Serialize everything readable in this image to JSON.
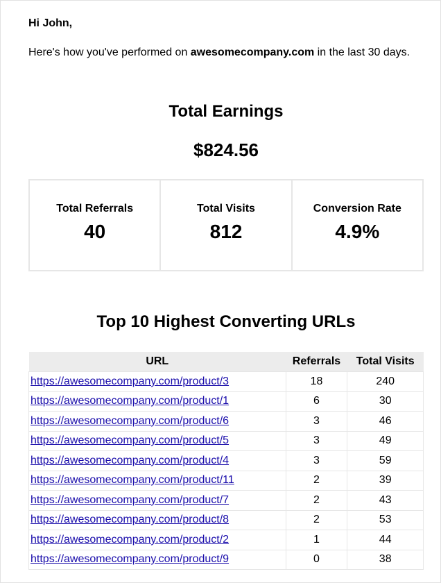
{
  "greeting": "Hi John,",
  "intro": {
    "prefix": "Here's how you've performed on ",
    "domain": "awesomecompany.com",
    "suffix": " in the last 30 days."
  },
  "earnings": {
    "title": "Total Earnings",
    "value": "$824.56"
  },
  "stats": [
    {
      "label": "Total Referrals",
      "value": "40"
    },
    {
      "label": "Total Visits",
      "value": "812"
    },
    {
      "label": "Conversion Rate",
      "value": "4.9%"
    }
  ],
  "top_urls": {
    "title": "Top 10 Highest Converting URLs",
    "headers": [
      "URL",
      "Referrals",
      "Total Visits"
    ],
    "rows": [
      {
        "url": "https://awesomecompany.com/product/3",
        "referrals": "18",
        "visits": "240"
      },
      {
        "url": "https://awesomecompany.com/product/1",
        "referrals": "6",
        "visits": "30"
      },
      {
        "url": "https://awesomecompany.com/product/6",
        "referrals": "3",
        "visits": "46"
      },
      {
        "url": "https://awesomecompany.com/product/5",
        "referrals": "3",
        "visits": "49"
      },
      {
        "url": "https://awesomecompany.com/product/4",
        "referrals": "3",
        "visits": "59"
      },
      {
        "url": "https://awesomecompany.com/product/11",
        "referrals": "2",
        "visits": "39"
      },
      {
        "url": "https://awesomecompany.com/product/7",
        "referrals": "2",
        "visits": "43"
      },
      {
        "url": "https://awesomecompany.com/product/8",
        "referrals": "2",
        "visits": "53"
      },
      {
        "url": "https://awesomecompany.com/product/2",
        "referrals": "1",
        "visits": "44"
      },
      {
        "url": "https://awesomecompany.com/product/9",
        "referrals": "0",
        "visits": "38"
      }
    ]
  },
  "colors": {
    "link": "#1a0dab",
    "header_bg": "#ececec",
    "border": "#e6e6e6"
  }
}
